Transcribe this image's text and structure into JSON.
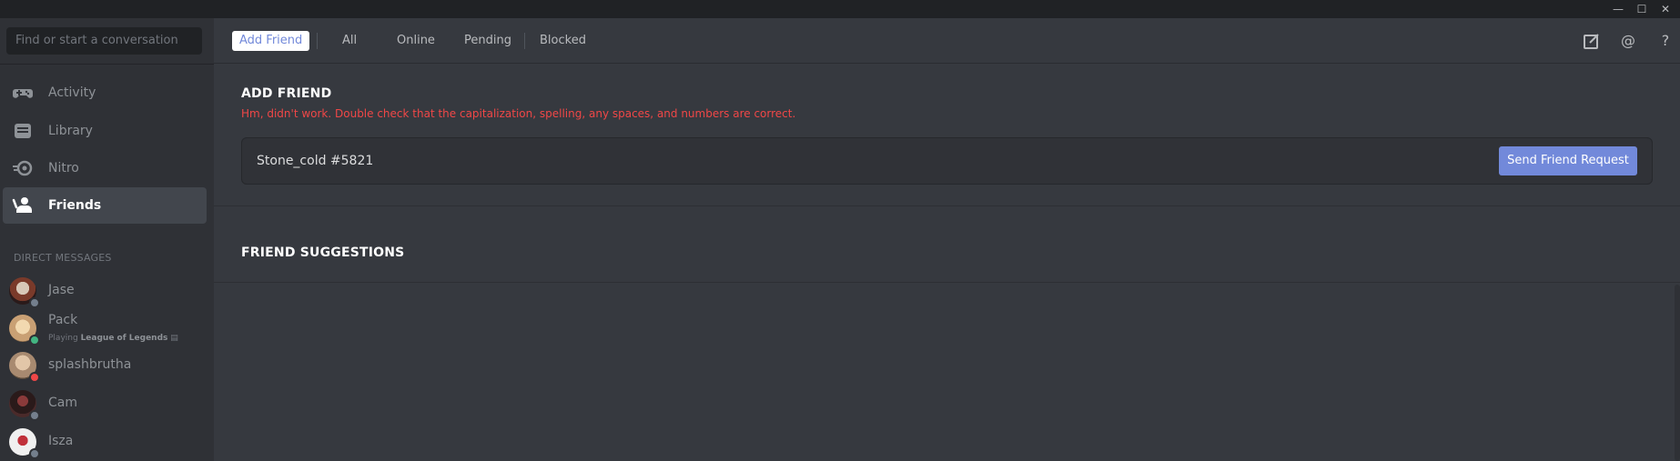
{
  "window": {
    "controls": {
      "minimize": "—",
      "maximize": "☐",
      "close": "✕"
    }
  },
  "sidebar": {
    "search_placeholder": "Find or start a conversation",
    "nav": [
      {
        "label": "Activity",
        "icon": "gamepad-icon",
        "active": false
      },
      {
        "label": "Library",
        "icon": "library-icon",
        "active": false
      },
      {
        "label": "Nitro",
        "icon": "nitro-icon",
        "active": false
      },
      {
        "label": "Friends",
        "icon": "friends-icon",
        "active": true
      }
    ],
    "dm_header": "DIRECT MESSAGES",
    "dms": [
      {
        "name": "Jase",
        "status": "offline",
        "status_color": "#747f8d"
      },
      {
        "name": "Pack",
        "status": "online",
        "status_color": "#43b581",
        "activity_prefix": "Playing",
        "activity_game": "League of Legends"
      },
      {
        "name": "splashbrutha",
        "status": "dnd",
        "status_color": "#f04747"
      },
      {
        "name": "Cam",
        "status": "offline",
        "status_color": "#747f8d"
      },
      {
        "name": "Isza",
        "status": "offline",
        "status_color": "#747f8d"
      }
    ]
  },
  "topbar": {
    "add_friend": "Add Friend",
    "tabs": [
      "All",
      "Online",
      "Pending",
      "Blocked"
    ],
    "tools": {
      "new_group": "new-group-dm-icon",
      "mentions": "@",
      "help": "?"
    }
  },
  "add_friend": {
    "title": "ADD FRIEND",
    "error": "Hm, didn't work. Double check that the capitalization, spelling, any spaces, and numbers are correct.",
    "input_value": "Stone_cold #5821",
    "button": "Send Friend Request"
  },
  "suggestions": {
    "title": "FRIEND SUGGESTIONS"
  },
  "colors": {
    "accent": "#7289da",
    "error": "#f04747",
    "online": "#43b581",
    "background": "#36393f",
    "sidebar": "#2f3136"
  }
}
